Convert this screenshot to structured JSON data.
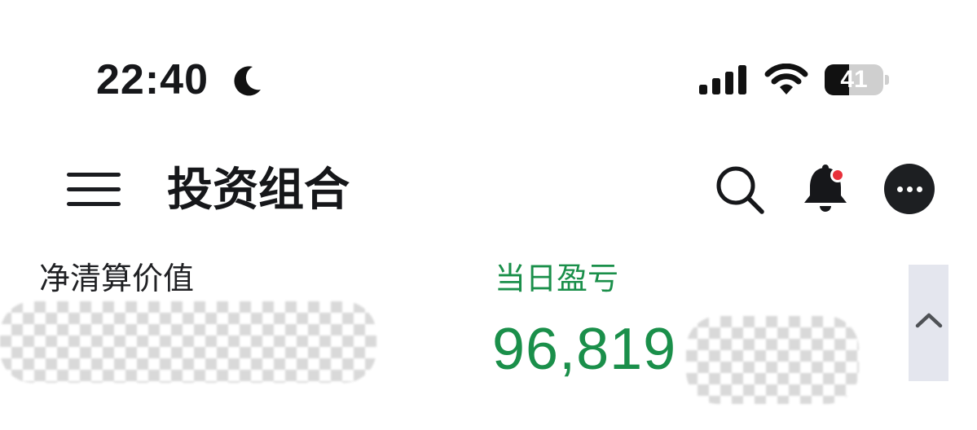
{
  "status_bar": {
    "time": "22:40",
    "focus_icon": "moon-icon",
    "signal_icon": "cellular-signal-icon",
    "wifi_icon": "wifi-icon",
    "battery_level": "41",
    "battery_fraction": 0.41
  },
  "header": {
    "title": "投资组合",
    "menu_icon": "hamburger-menu-icon",
    "search_icon": "search-icon",
    "notification_icon": "bell-icon",
    "notification_badge_color": "#e8303a",
    "more_icon": "more-options-icon"
  },
  "summary": {
    "net_liquidation_label": "净清算价值",
    "net_liquidation_value": "",
    "daily_pnl_label": "当日盈亏",
    "daily_pnl_value": "96,819",
    "daily_pnl_color": "#1a8f4a",
    "collapse_icon": "chevron-up-icon"
  }
}
